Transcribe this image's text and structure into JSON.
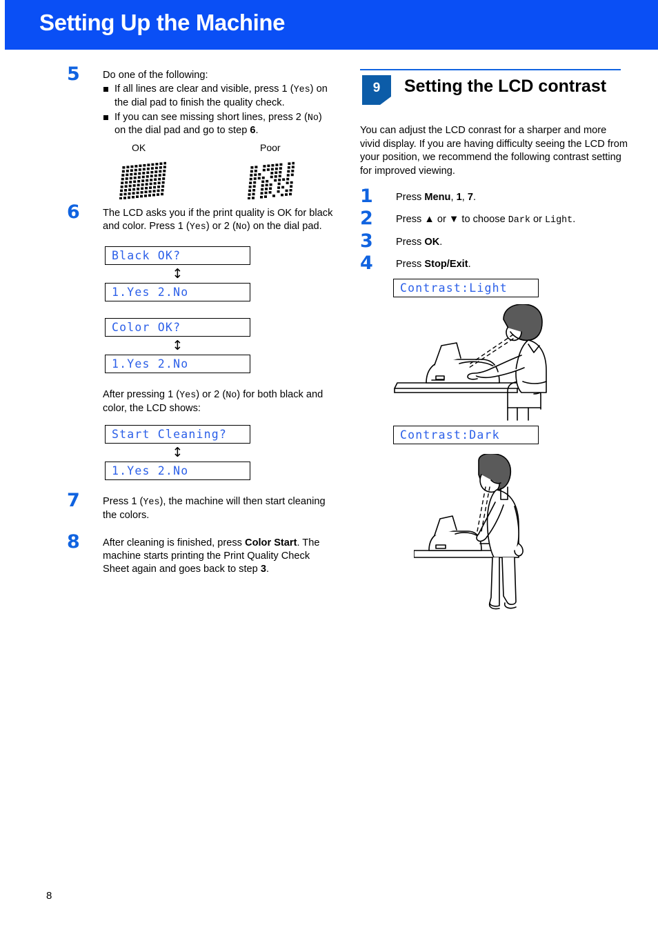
{
  "header": {
    "title": "Setting Up the Machine"
  },
  "page": {
    "number": "8"
  },
  "left_column": {
    "step5": {
      "number": "5",
      "intro": "Do one of the following:",
      "bullets": [
        {
          "pre": "If all lines are clear and visible, press 1 (",
          "mono": "Yes",
          "post": ") on the dial pad  to finish the quality check."
        },
        {
          "pre": "If you can see missing short lines, press 2 (",
          "mono": "No",
          "post": ") on the dial pad and go to step ",
          "bold": "6",
          "tail": "."
        }
      ],
      "samples": {
        "ok_label": "OK",
        "poor_label": "Poor"
      }
    },
    "step6": {
      "number": "6",
      "text_a": "The LCD asks you if the print quality is OK for black and color. Press 1 (",
      "mono_a": "Yes",
      "text_b": ") or 2 (",
      "mono_b": "No",
      "text_c": ") on the dial pad.",
      "lcd_black": "Black OK?",
      "lcd_yesno_1": "1.Yes 2.No",
      "lcd_color": "Color OK?",
      "lcd_yesno_2": "1.Yes 2.No",
      "after_text_a": "After pressing 1 (",
      "after_mono_a": "Yes",
      "after_text_b": ") or 2 (",
      "after_mono_b": "No",
      "after_text_c": ") for both black and color, the LCD shows:",
      "lcd_cleaning": "Start Cleaning?",
      "lcd_yesno_3": "1.Yes 2.No",
      "arrow": "↕"
    },
    "step7": {
      "number": "7",
      "text_a": "Press 1 (",
      "mono_a": "Yes",
      "text_b": "), the machine will then start cleaning the colors."
    },
    "step8": {
      "number": "8",
      "text_a": "After cleaning is finished, press ",
      "bold_a": "Color Start",
      "text_b": ". The machine starts printing the Print Quality Check Sheet again and goes back to step ",
      "bold_b": "3",
      "text_c": "."
    }
  },
  "right_column": {
    "section": {
      "badge": "9",
      "title": "Setting the LCD contrast",
      "intro": "You can adjust the LCD conrast for a sharper and more vivid display. If you are having difficulty seeing the LCD from your position, we recommend the following contrast setting for improved viewing."
    },
    "step1": {
      "number": "1",
      "text_a": "Press ",
      "bold_a": "Menu",
      "text_b": ", ",
      "bold_b": "1",
      "text_c": ", ",
      "bold_c": "7",
      "text_d": "."
    },
    "step2": {
      "number": "2",
      "text_a": "Press ",
      "up_arrow": "▲",
      "text_b": " or ",
      "down_arrow": "▼",
      "text_c": " to choose ",
      "mono_a": "Dark",
      "text_d": " or ",
      "mono_b": "Light",
      "text_e": "."
    },
    "step3": {
      "number": "3",
      "text_a": "Press ",
      "bold_a": "OK",
      "text_b": "."
    },
    "step4": {
      "number": "4",
      "text_a": "Press ",
      "bold_a": "Stop/Exit",
      "text_b": "."
    },
    "lcd_light": "Contrast:Light",
    "lcd_dark": "Contrast:Dark",
    "illustration_seated": "person-seated-at-desk-viewing-machine",
    "illustration_standing": "person-standing-viewing-machine"
  },
  "colors": {
    "header_blue": "#0A4FF5",
    "step_number_blue": "#1063E0",
    "badge_blue": "#0C5CA8",
    "lcd_text_blue": "#2B5FE8"
  }
}
